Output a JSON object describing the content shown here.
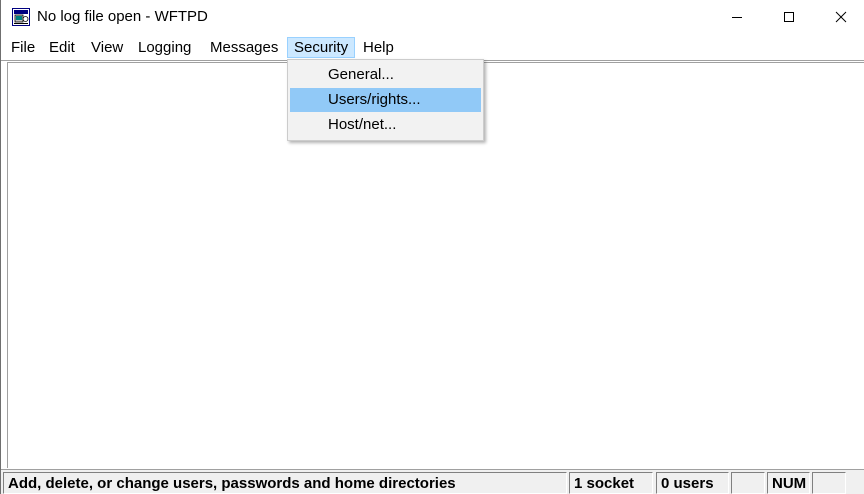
{
  "window": {
    "title": "No log file open - WFTPD",
    "app_icon": "wftpd-app-icon"
  },
  "titlebar_buttons": {
    "minimize_icon": "minimize-icon",
    "maximize_icon": "maximize-icon",
    "close_icon": "close-icon"
  },
  "menubar": {
    "items": [
      {
        "label": "File"
      },
      {
        "label": "Edit"
      },
      {
        "label": "View"
      },
      {
        "label": "Logging"
      },
      {
        "label": "Messages"
      },
      {
        "label": "Security",
        "active": true
      },
      {
        "label": "Help"
      }
    ]
  },
  "security_menu": {
    "items": [
      {
        "label": "General..."
      },
      {
        "label": "Users/rights...",
        "highlighted": true
      },
      {
        "label": "Host/net..."
      }
    ]
  },
  "statusbar": {
    "message": "Add, delete, or change users, passwords and home directories",
    "sockets": "1 socket",
    "users": "0 users",
    "pane_blank": "",
    "num": "NUM",
    "pane_blank2": ""
  },
  "colors": {
    "menu_active_bg": "#cce8ff",
    "menu_highlight_bg": "#91c9f7",
    "statusbar_bg": "#f0f0f0"
  }
}
